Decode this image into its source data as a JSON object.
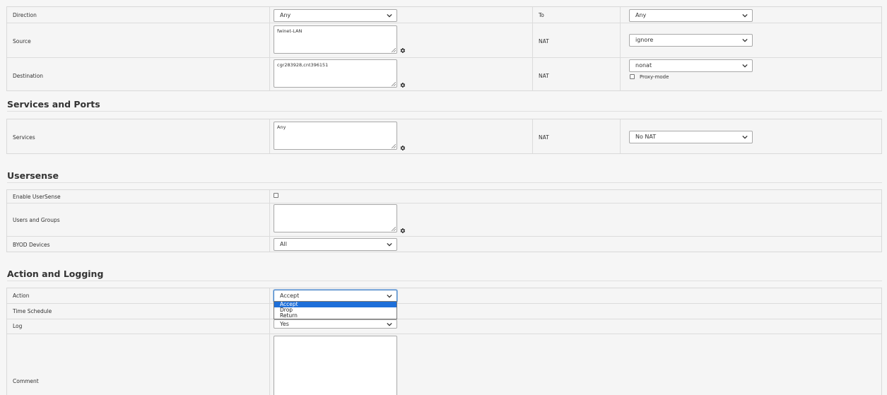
{
  "general": {
    "direction_label": "Direction",
    "direction_value": "Any",
    "to_label": "To",
    "to_value": "Any",
    "source_label": "Source",
    "source_value": "fwinet-LAN",
    "source_nat_label": "NAT",
    "source_nat_value": "ignore",
    "destination_label": "Destination",
    "destination_value": "cgr283928,cnt396151",
    "destination_nat_label": "NAT",
    "destination_nat_value": "nonat",
    "proxy_mode_label": "Proxy-mode"
  },
  "services": {
    "heading": "Services and Ports",
    "services_label": "Services",
    "services_value": "Any",
    "nat_label": "NAT",
    "nat_value": "No NAT"
  },
  "usersense": {
    "heading": "Usersense",
    "enable_label": "Enable UserSense",
    "users_groups_label": "Users and Groups",
    "users_groups_value": "",
    "byod_label": "BYOD Devices",
    "byod_value": "All"
  },
  "action": {
    "heading": "Action and Logging",
    "action_label": "Action",
    "action_value": "Accept",
    "action_options": [
      "Accept",
      "Drop",
      "Return"
    ],
    "time_schedule_label": "Time Schedule",
    "log_label": "Log",
    "log_value": "Yes",
    "comment_label": "Comment",
    "comment_value": ""
  },
  "colors": {
    "accent": "#1e6fd9",
    "background": "#f6f6f6",
    "border": "#d9d9d9"
  },
  "icons": {
    "gear": "gear-icon",
    "chevron": "chevron-down-icon",
    "resize": "resize-grip-icon"
  }
}
